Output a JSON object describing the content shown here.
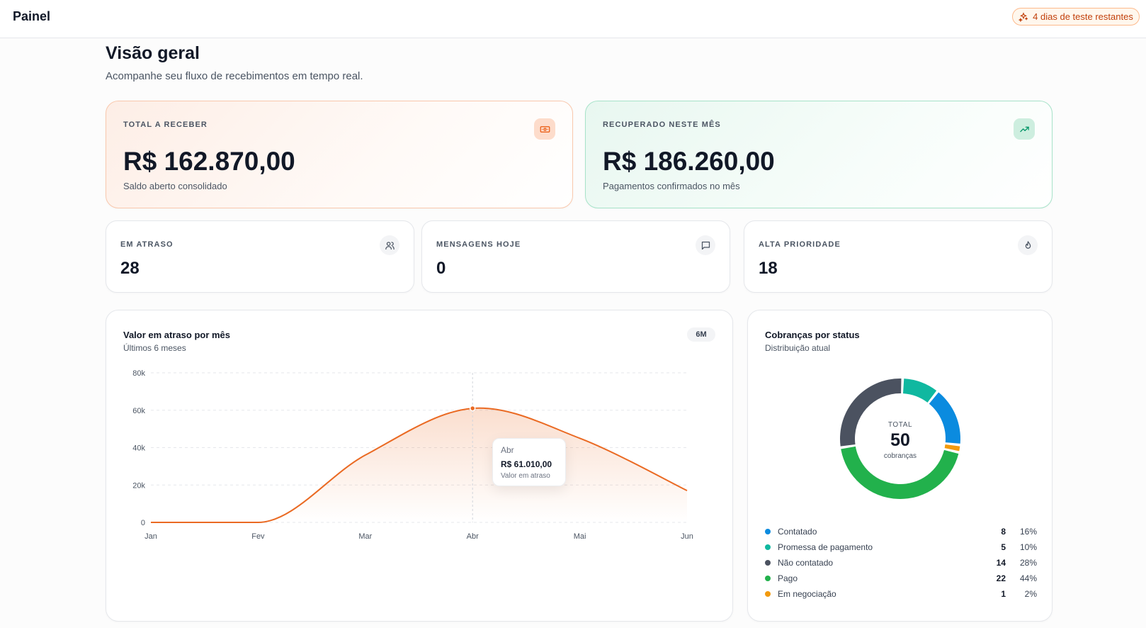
{
  "header": {
    "title": "Painel",
    "trial_label": "4 dias de teste restantes",
    "trial_icon": "sparkles-icon"
  },
  "page": {
    "title": "Visão geral",
    "subtitle": "Acompanhe seu fluxo de recebimentos em tempo real."
  },
  "kpis_big": [
    {
      "label": "TOTAL A RECEBER",
      "value": "R$ 162.870,00",
      "caption": "Saldo aberto consolidado",
      "icon": "money-icon",
      "accent": "#ea580c"
    },
    {
      "label": "RECUPERADO NESTE MÊS",
      "value": "R$ 186.260,00",
      "caption": "Pagamentos confirmados no mês",
      "icon": "trending-up-icon",
      "accent": "#059669"
    }
  ],
  "kpis_small": [
    {
      "label": "EM ATRASO",
      "value": "28",
      "icon": "users-icon"
    },
    {
      "label": "MENSAGENS HOJE",
      "value": "0",
      "icon": "message-icon"
    },
    {
      "label": "ALTA PRIORIDADE",
      "value": "18",
      "icon": "flame-icon"
    }
  ],
  "line_panel": {
    "title": "Valor em atraso por mês",
    "subtitle": "Últimos 6 meses",
    "range": "6M",
    "tooltip": {
      "month": "Abr",
      "value": "R$ 61.010,00",
      "label": "Valor em atraso"
    }
  },
  "donut_panel": {
    "title": "Cobranças por status",
    "subtitle": "Distribuição atual",
    "center_label": "TOTAL",
    "center_value": "50",
    "center_sub": "cobranças",
    "legend": [
      {
        "name": "Contatado",
        "count": "8",
        "pct": "16%",
        "color": "#0b8bdf"
      },
      {
        "name": "Promessa de pagamento",
        "count": "5",
        "pct": "10%",
        "color": "#10b8a0"
      },
      {
        "name": "Não contatado",
        "count": "14",
        "pct": "28%",
        "color": "#4b5260"
      },
      {
        "name": "Pago",
        "count": "22",
        "pct": "44%",
        "color": "#22b14c"
      },
      {
        "name": "Em negociação",
        "count": "1",
        "pct": "2%",
        "color": "#f29a0e"
      }
    ]
  },
  "chart_data": [
    {
      "type": "area",
      "title": "Valor em atraso por mês",
      "categories": [
        "Jan",
        "Fev",
        "Mar",
        "Abr",
        "Mai",
        "Jun"
      ],
      "values": [
        0,
        0,
        36000,
        61010,
        45000,
        17000
      ],
      "ylim": [
        0,
        80000
      ],
      "yticks": [
        "0",
        "20k",
        "40k",
        "60k",
        "80k"
      ],
      "grid": true,
      "color": "#ea6a23",
      "highlight_index": 3
    },
    {
      "type": "pie",
      "title": "Cobranças por status",
      "categories": [
        "Contatado",
        "Promessa de pagamento",
        "Não contatado",
        "Pago",
        "Em negociação"
      ],
      "values": [
        8,
        5,
        14,
        22,
        1
      ],
      "order_clockwise_from_top": [
        "Promessa de pagamento",
        "Contatado",
        "Em negociação",
        "Pago",
        "Não contatado"
      ]
    }
  ]
}
